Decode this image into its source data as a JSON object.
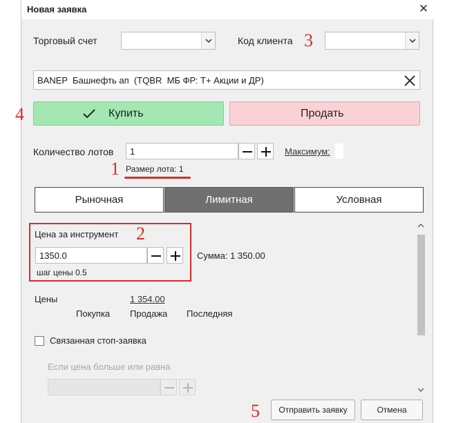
{
  "window": {
    "title": "Новая заявка"
  },
  "account": {
    "label": "Торговый счет",
    "value": ""
  },
  "client": {
    "label": "Код клиента",
    "value": ""
  },
  "instrument": {
    "text": "BANEP  Башнефть ап  (TQBR  МБ ФР: Т+ Акции и ДР)"
  },
  "side": {
    "buy_label": "Купить",
    "sell_label": "Продать",
    "selected": "Купить"
  },
  "lots": {
    "label": "Количество лотов",
    "value": "1",
    "maximum_label": "Максимум:",
    "lot_size_label": "Размер лота: 1"
  },
  "tabs": [
    {
      "label": "Рыночная",
      "active": false
    },
    {
      "label": "Лимитная",
      "active": true
    },
    {
      "label": "Условная",
      "active": false
    }
  ],
  "price": {
    "label": "Цена за инструмент",
    "value": "1350.0",
    "step_label": "шаг цены 0.5",
    "sum_label": "Сумма:  1 350.00"
  },
  "prices": {
    "label": "Цены",
    "value": "1 354.00",
    "columns": [
      "Покупка",
      "Продажа",
      "Последняя"
    ]
  },
  "stop": {
    "checkbox_label": "Связанная стоп-заявка",
    "checked": false,
    "condition_label": "Если цена больше или равна",
    "value": ""
  },
  "footer": {
    "submit_label": "Отправить заявку",
    "cancel_label": "Отмена"
  },
  "annotations": {
    "lot_size": "1",
    "price_box": "2",
    "client_code": "3",
    "buy": "4",
    "submit": "5"
  },
  "colors": {
    "buy": "#a3e7b3",
    "sell": "#fad2d5",
    "active_tab": "#6f6f6f",
    "annotation": "#d62b2b"
  }
}
